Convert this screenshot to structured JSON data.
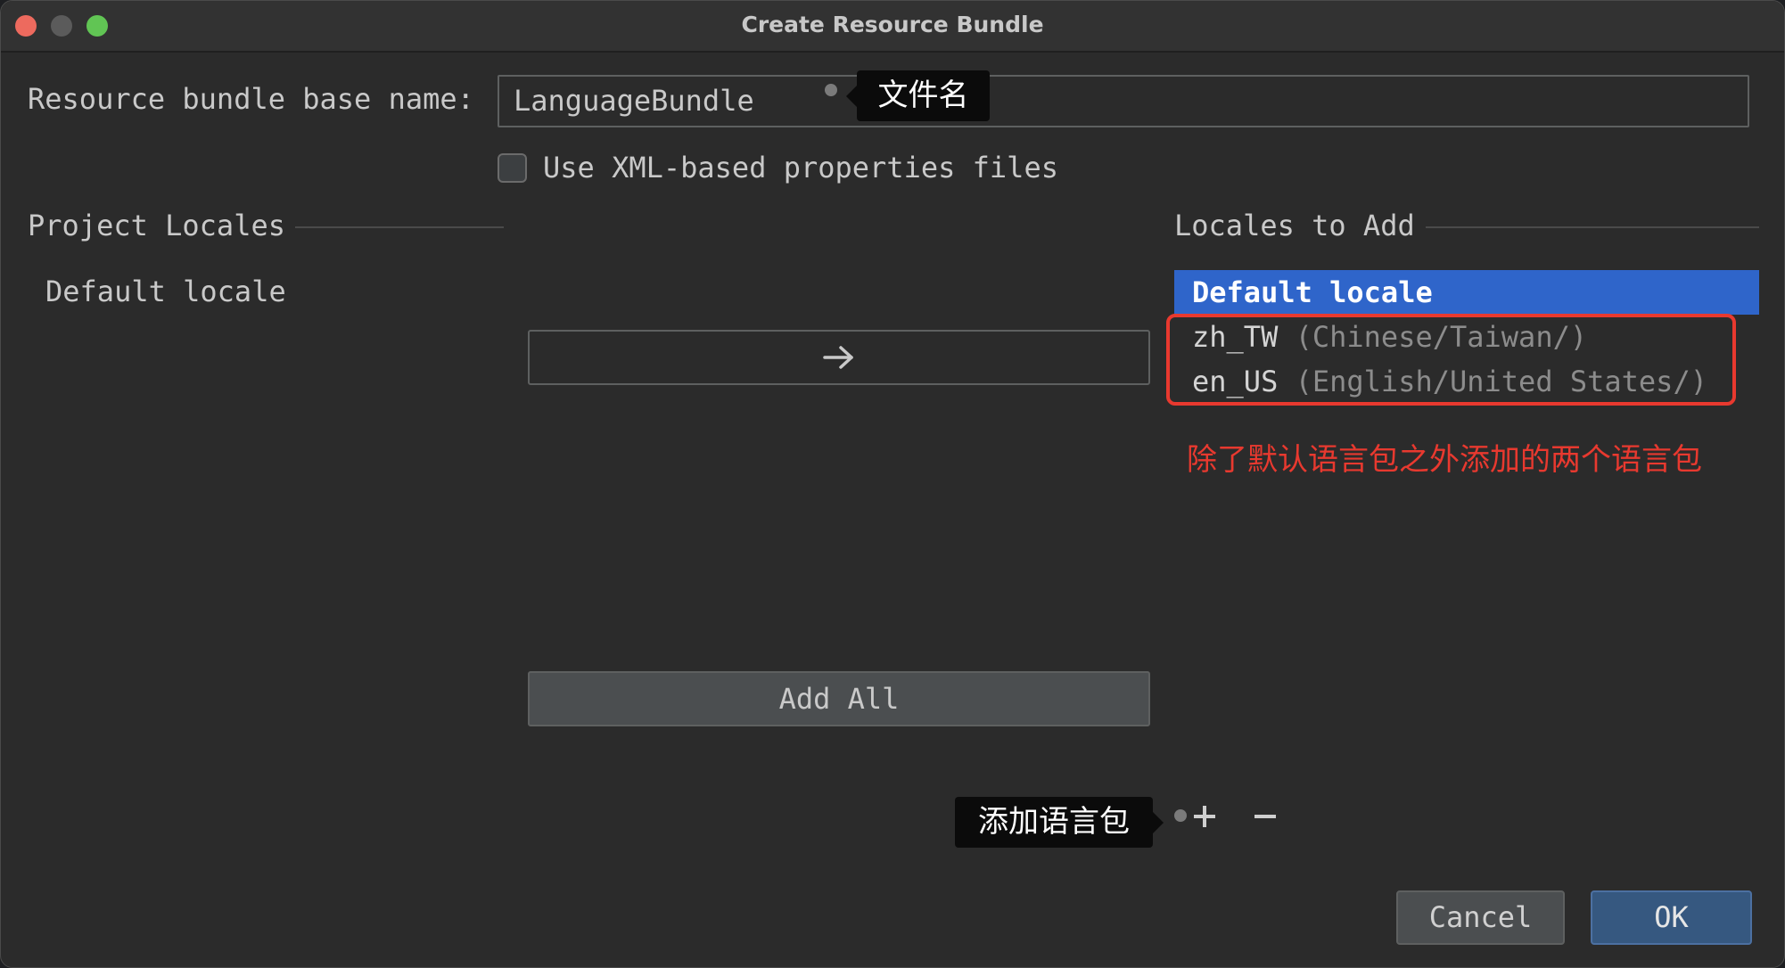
{
  "window": {
    "title": "Create Resource Bundle"
  },
  "form": {
    "base_name_label": "Resource bundle base name:",
    "base_name_value": "LanguageBundle",
    "xml_checkbox_label": "Use XML-based properties files",
    "xml_checked": false
  },
  "project_locales": {
    "header": "Project Locales",
    "items": [
      "Default locale"
    ]
  },
  "locales_to_add": {
    "header": "Locales to Add",
    "items": [
      {
        "code": "Default locale",
        "desc": "",
        "selected": true
      },
      {
        "code": "zh_TW",
        "desc": " (Chinese/Taiwan/)",
        "selected": false
      },
      {
        "code": "en_US",
        "desc": " (English/United States/)",
        "selected": false
      }
    ]
  },
  "buttons": {
    "add_all": "Add All",
    "cancel": "Cancel",
    "ok": "OK"
  },
  "annotations": {
    "filename_tooltip": "文件名",
    "added_locales_note": "除了默认语言包之外添加的两个语言包",
    "add_locale_tooltip": "添加语言包"
  },
  "colors": {
    "selection": "#2f65ca",
    "annotation_red": "#e8392f",
    "ok_button": "#365880"
  },
  "icons": {
    "move_right": "arrow-right-icon",
    "add": "plus-icon",
    "remove": "minus-icon"
  }
}
